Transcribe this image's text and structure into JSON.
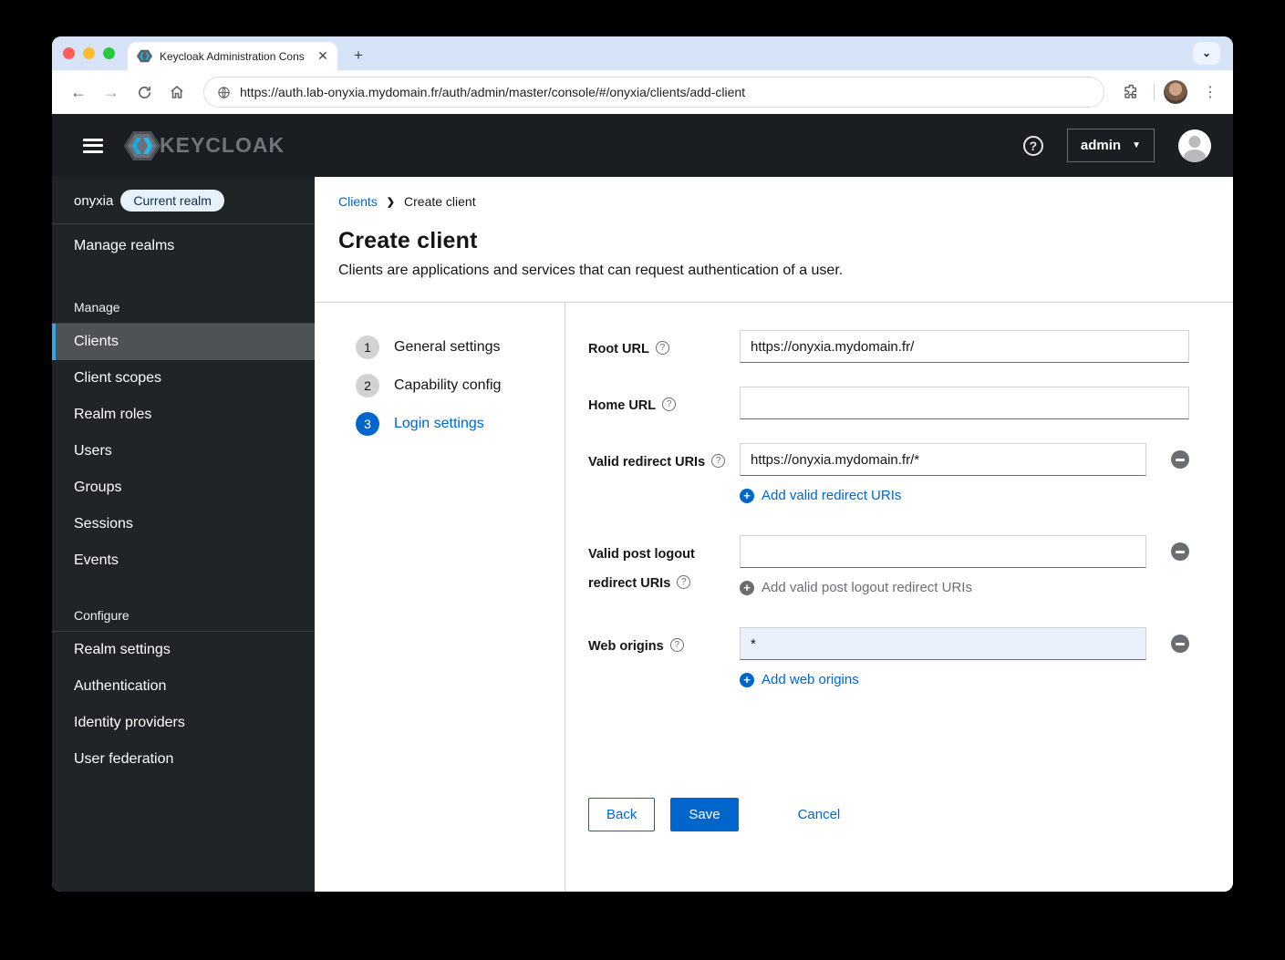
{
  "colors": {
    "accent": "#0066cc",
    "masthead": "#1a1d21",
    "sidebar": "#212427",
    "active_indicator": "#39a5dc",
    "highlight_input_bg": "#e9f1fc"
  },
  "browser": {
    "tab_title": "Keycloak Administration Cons",
    "close_glyph": "✕",
    "new_tab_glyph": "+",
    "url": "https://auth.lab-onyxia.mydomain.fr/auth/admin/master/console/#/onyxia/clients/add-client"
  },
  "masthead": {
    "brand": "KEYCLOAK",
    "help_glyph": "?",
    "user": "admin"
  },
  "sidebar": {
    "realm": "onyxia",
    "realm_badge": "Current realm",
    "top_item": "Manage realms",
    "manage_label": "Manage",
    "manage_items": [
      "Clients",
      "Client scopes",
      "Realm roles",
      "Users",
      "Groups",
      "Sessions",
      "Events"
    ],
    "configure_label": "Configure",
    "configure_items": [
      "Realm settings",
      "Authentication",
      "Identity providers",
      "User federation"
    ],
    "active_item": "Clients"
  },
  "breadcrumb": {
    "parent": "Clients",
    "separator": "❯",
    "current": "Create client"
  },
  "page": {
    "title": "Create client",
    "subtitle": "Clients are applications and services that can request authentication of a user."
  },
  "wizard": {
    "steps": [
      {
        "num": "1",
        "label": "General settings"
      },
      {
        "num": "2",
        "label": "Capability config"
      },
      {
        "num": "3",
        "label": "Login settings"
      }
    ],
    "active_step": "Login settings"
  },
  "form": {
    "help_glyph": "?",
    "root_url": {
      "label": "Root URL",
      "value": "https://onyxia.mydomain.fr/"
    },
    "home_url": {
      "label": "Home URL",
      "value": ""
    },
    "valid_redirect_uris": {
      "label": "Valid redirect URIs",
      "value": "https://onyxia.mydomain.fr/*",
      "add_label": "Add valid redirect URIs"
    },
    "post_logout_uris": {
      "label_line1": "Valid post logout",
      "label_line2": "redirect URIs",
      "value": "",
      "add_label": "Add valid post logout redirect URIs"
    },
    "web_origins": {
      "label": "Web origins",
      "value": "*",
      "add_label": "Add web origins"
    }
  },
  "actions": {
    "back": "Back",
    "save": "Save",
    "cancel": "Cancel"
  }
}
